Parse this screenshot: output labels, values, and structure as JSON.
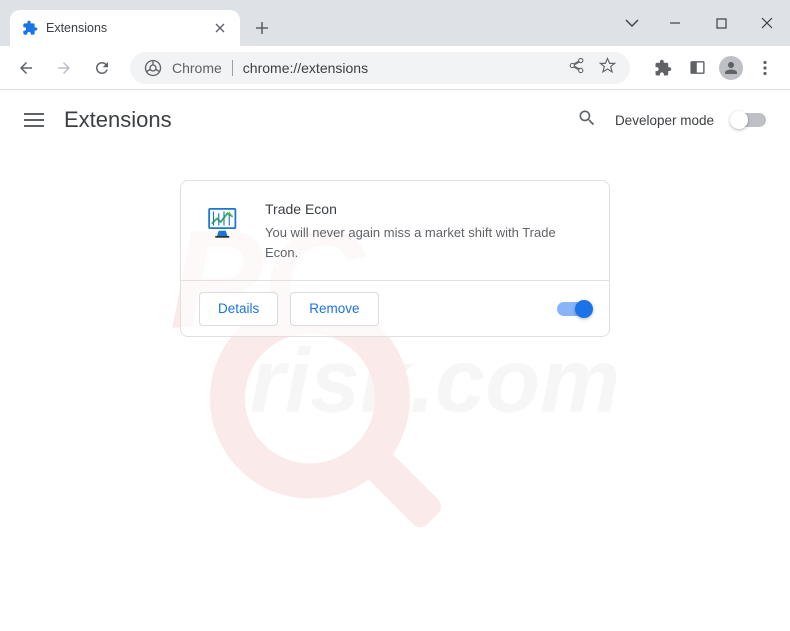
{
  "window": {
    "tab_title": "Extensions"
  },
  "omnibox": {
    "prefix": "Chrome",
    "url": "chrome://extensions"
  },
  "page": {
    "title": "Extensions",
    "developer_mode_label": "Developer mode"
  },
  "extension": {
    "name": "Trade Econ",
    "description": "You will never again miss a market shift with Trade Econ.",
    "details_button": "Details",
    "remove_button": "Remove",
    "enabled": true
  }
}
